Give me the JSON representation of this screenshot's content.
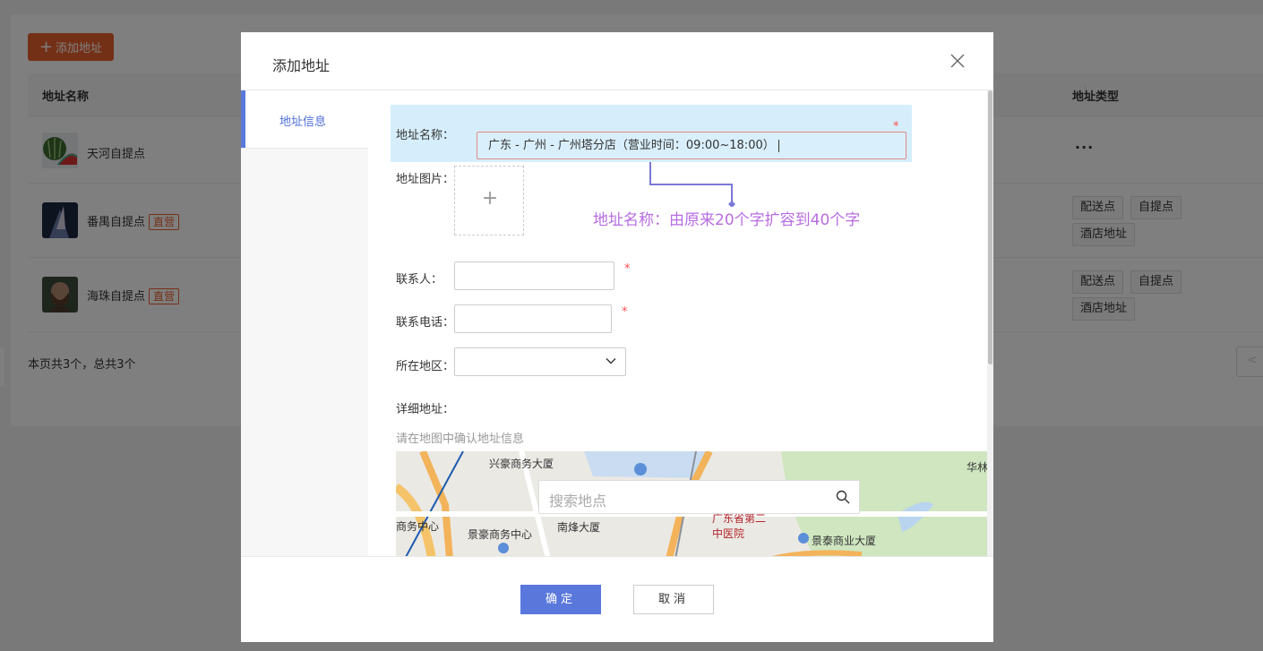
{
  "background": {
    "add_button_label": "添加地址",
    "columns": [
      "地址名称",
      "地址类型"
    ],
    "rows": [
      {
        "name": "天河自提点",
        "badge": "",
        "types": []
      },
      {
        "name": "番禺自提点",
        "badge": "直营",
        "types": [
          "配送点",
          "自提点",
          "酒店地址"
        ]
      },
      {
        "name": "海珠自提点",
        "badge": "直营",
        "types": [
          "配送点",
          "自提点",
          "酒店地址"
        ]
      }
    ],
    "more_label": "···",
    "summary": "本页共3个，总共3个"
  },
  "modal": {
    "title": "添加地址",
    "side_tab": "地址信息",
    "fields": {
      "name_label": "地址名称：",
      "name_value": "广东 - 广州 - 广州塔分店（营业时间：09:00~18:00）",
      "image_label": "地址图片：",
      "upload_plus": "+",
      "contact_label": "联系人：",
      "phone_label": "联系电话：",
      "region_label": "所在地区：",
      "detail_label": "详细地址：",
      "required": "*"
    },
    "annotation": "地址名称：由原来20个字扩容到40个字",
    "map_hint": "请在地图中确认地址信息",
    "map": {
      "search_placeholder": "搜索地点",
      "labels": [
        "兴豪商务大厦",
        "华林",
        "商务中心",
        "景豪商务中心",
        "南烽大厦",
        "广东省第二中医院",
        "景泰商业大厦"
      ]
    },
    "ok_label": "确定",
    "cancel_label": "取消"
  },
  "colors": {
    "accent": "#5a78dc",
    "brand_orange": "#e8602c",
    "annotation": "#b76ce0",
    "highlight": "#d6eefb"
  }
}
